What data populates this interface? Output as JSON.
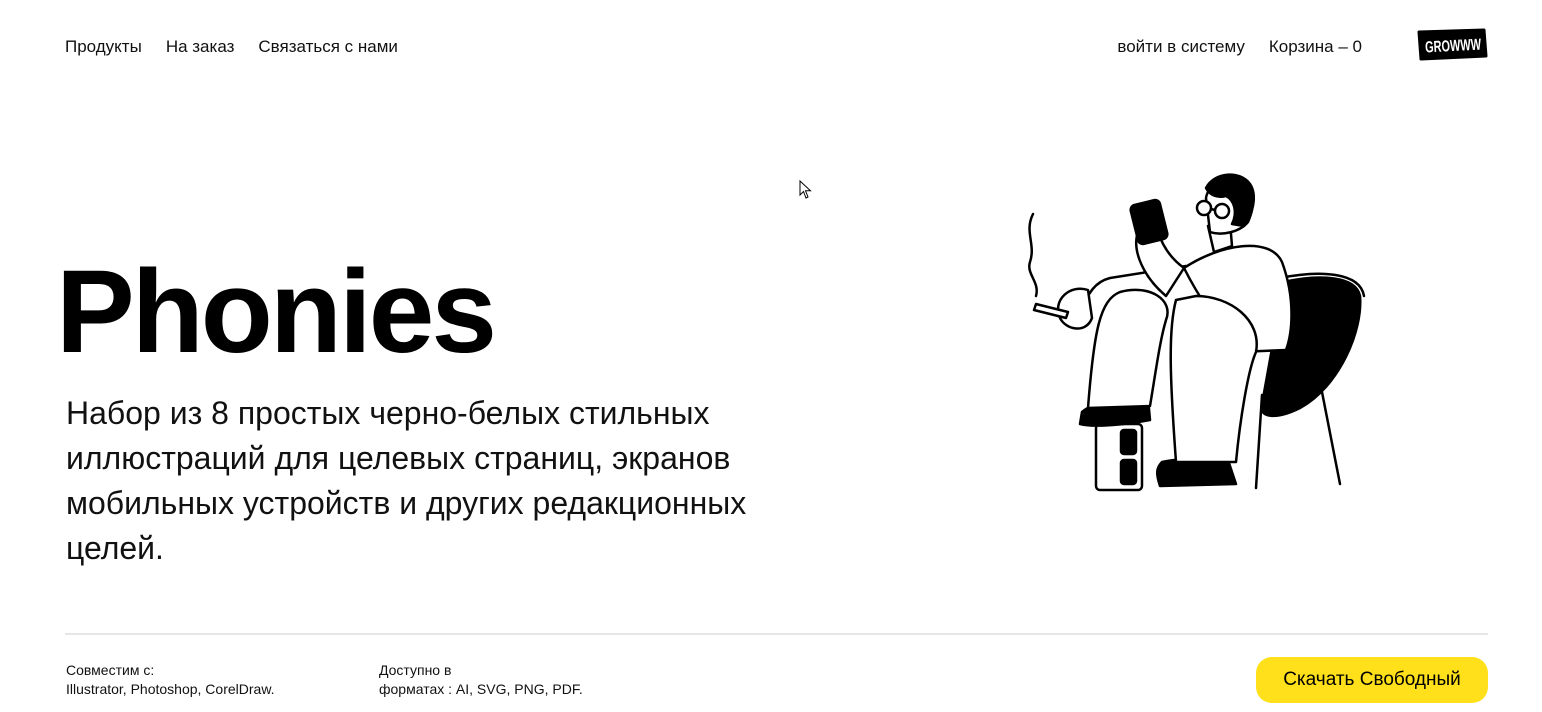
{
  "nav": {
    "left": [
      {
        "label": "Продукты"
      },
      {
        "label": "На заказ"
      },
      {
        "label": "Связаться с нами"
      }
    ],
    "login_label": "войти в систему",
    "cart_label": "Корзина – 0"
  },
  "logo": {
    "text": "GROWWW",
    "icon": "growww-logo"
  },
  "hero": {
    "title": "Phonies",
    "description": "Набор из 8 простых черно-белых стильных иллюстраций для целевых страниц, экранов мобильных устройств и других редакционных целей."
  },
  "illustration": {
    "icon": "man-with-phone-illustration"
  },
  "footer": {
    "compat_label": "Совместим с:",
    "compat_value": "Illustrator, Photoshop, CorelDraw.",
    "formats_label": "Доступно в",
    "formats_value": "форматах : AI, SVG, PNG, PDF.",
    "download_label": "Скачать  Свободный"
  },
  "colors": {
    "accent": "#ffe01b",
    "text": "#000000",
    "divider": "#e6e6e6"
  }
}
